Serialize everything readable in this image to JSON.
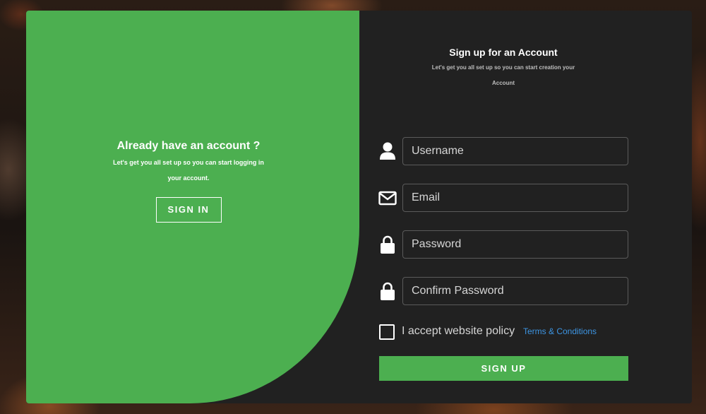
{
  "colors": {
    "accent": "#4caf50",
    "panel": "#212121",
    "link": "#3d95e3",
    "input_border": "#5b5b5b"
  },
  "left_panel": {
    "title": "Already have an account ?",
    "subtitle": "Let's get you all set up so you can start logging in your account.",
    "signin_label": "SIGN IN"
  },
  "right_panel": {
    "title": "Sign up for an Account",
    "subtitle": "Let's get you all set up so you can start creation your Account"
  },
  "form": {
    "fields": [
      {
        "name": "username",
        "icon": "user-icon",
        "placeholder": "Username",
        "value": ""
      },
      {
        "name": "email",
        "icon": "envelope-icon",
        "placeholder": "Email",
        "value": ""
      },
      {
        "name": "password",
        "icon": "lock-icon",
        "placeholder": "Password",
        "value": ""
      },
      {
        "name": "confirm_password",
        "icon": "lock-icon",
        "placeholder": "Confirm Password",
        "value": ""
      }
    ],
    "policy_label": "I accept website policy",
    "policy_checked": false,
    "terms_link": "Terms & Conditions",
    "signup_label": "SIGN UP"
  }
}
